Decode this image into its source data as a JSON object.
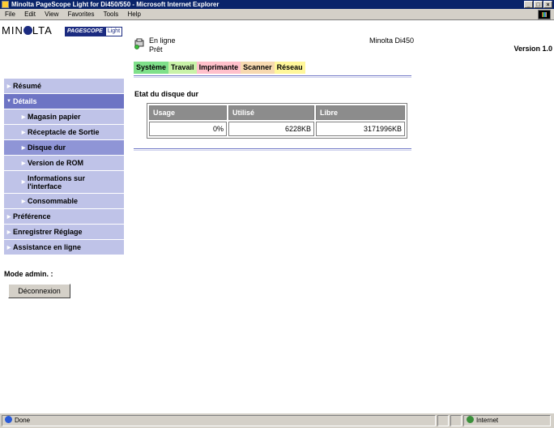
{
  "window": {
    "title": "Minolta PageScope Light for Di450/550 - Microsoft Internet Explorer",
    "controls": [
      "_",
      "□",
      "×"
    ]
  },
  "menu": {
    "items": [
      "File",
      "Edit",
      "View",
      "Favorites",
      "Tools",
      "Help"
    ]
  },
  "logo": {
    "brand_left": "MIN",
    "brand_right": "LTA",
    "product": "PAGESCOPE",
    "product_suffix": "Light",
    "version": "Version 1.0"
  },
  "nav": {
    "items": [
      {
        "label": "Résumé",
        "level": 0,
        "open": false
      },
      {
        "label": "Détails",
        "level": 0,
        "open": true
      },
      {
        "label": "Magasin papier",
        "level": 1
      },
      {
        "label": "Réceptacle de Sortie",
        "level": 1
      },
      {
        "label": "Disque dur",
        "level": 1,
        "selected": true
      },
      {
        "label": "Version de ROM",
        "level": 1
      },
      {
        "label": "Informations sur l'interface",
        "level": 1
      },
      {
        "label": "Consommable",
        "level": 1
      },
      {
        "label": "Préférence",
        "level": 0
      },
      {
        "label": "Enregistrer Réglage",
        "level": 0
      },
      {
        "label": "Assistance en ligne",
        "level": 0
      }
    ]
  },
  "admin": {
    "label": "Mode admin. :",
    "logout_label": "Déconnexion"
  },
  "status": {
    "online": "En ligne",
    "ready": "Prêt",
    "model": "Minolta Di450"
  },
  "tabs": [
    {
      "label": "Système",
      "color": "#7fe08a"
    },
    {
      "label": "Travail",
      "color": "#c9f2a8"
    },
    {
      "label": "Imprimante",
      "color": "#ffc0cb"
    },
    {
      "label": "Scanner",
      "color": "#f7d9b0"
    },
    {
      "label": "Réseau",
      "color": "#fff79a"
    }
  ],
  "disk": {
    "title": "Etat du disque dur",
    "columns": [
      "Usage",
      "Utilisé",
      "Libre"
    ],
    "row": [
      "0%",
      "6228KB",
      "3171996KB"
    ]
  },
  "statusbar": {
    "left": "Done",
    "zone": "Internet"
  }
}
